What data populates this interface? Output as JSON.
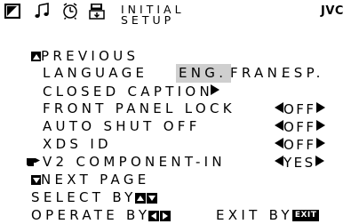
{
  "header": {
    "icons": [
      "tv-icon",
      "music-note-icon",
      "clock-icon",
      "save-icon"
    ],
    "title_line1": "INITIAL",
    "title_line2": "SETUP",
    "brand": "JVC"
  },
  "menu": {
    "previous": "PREVIOUS",
    "language": {
      "label": "LANGUAGE",
      "options": [
        "ENG.",
        "FRAN.",
        "ESP."
      ],
      "selected": "ENG."
    },
    "closed_caption": "CLOSED CAPTION",
    "front_panel_lock": {
      "label": "FRONT PANEL LOCK",
      "value": "OFF"
    },
    "auto_shut_off": {
      "label": "AUTO SHUT OFF",
      "value": "OFF"
    },
    "xds_id": {
      "label": "XDS ID",
      "value": "OFF"
    },
    "v2_component_in": {
      "label": "V2 COMPONENT-IN",
      "value": "YES"
    },
    "next_page": "NEXT PAGE"
  },
  "footer": {
    "select_by": "SELECT BY",
    "operate_by": "OPERATE BY",
    "exit_by": "EXIT BY",
    "exit_key": "EXIT"
  }
}
